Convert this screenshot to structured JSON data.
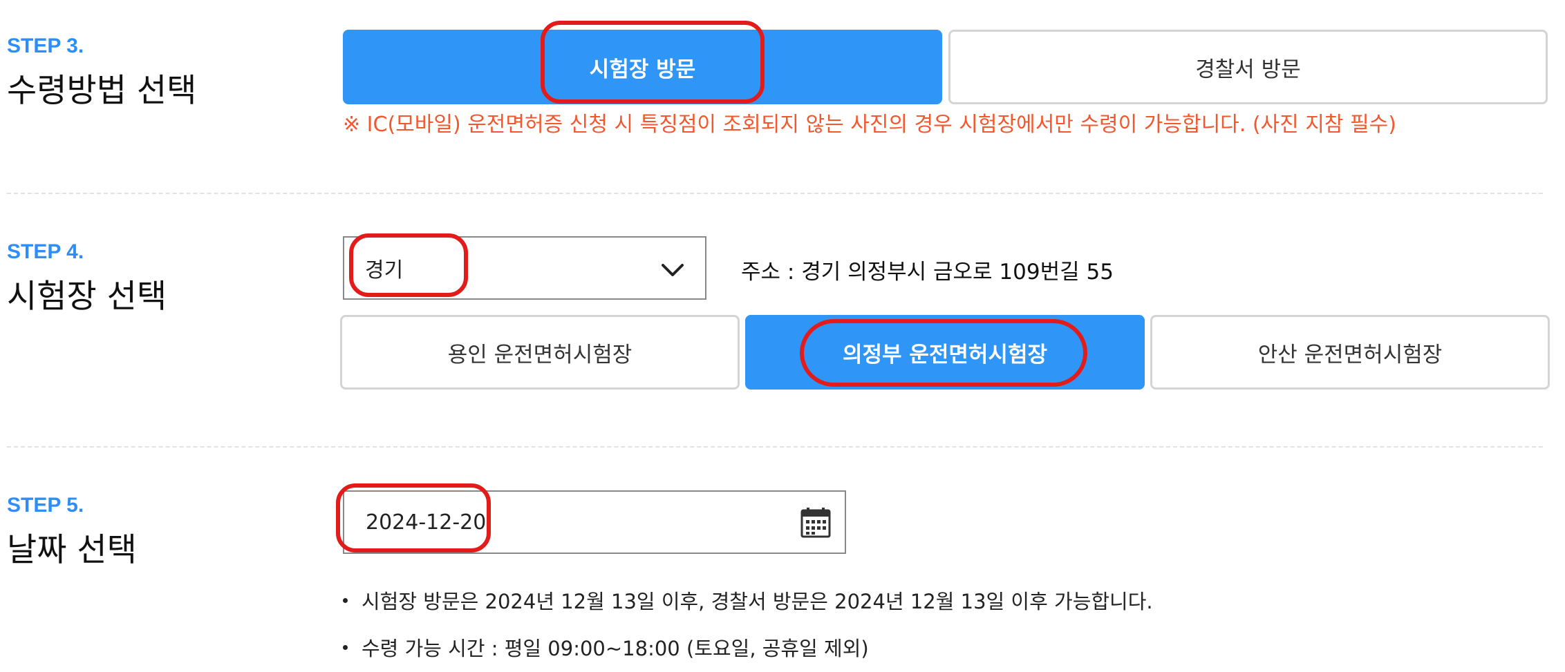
{
  "step3": {
    "label": "STEP 3.",
    "title": "수령방법 선택",
    "options": [
      "시험장 방문",
      "경찰서 방문"
    ],
    "selected": "시험장 방문",
    "notice": "※ IC(모바일) 운전면허증 신청 시 특징점이 조회되지 않는 사진의 경우 시험장에서만 수령이 가능합니다. (사진 지참 필수)"
  },
  "step4": {
    "label": "STEP 4.",
    "title": "시험장 선택",
    "region_value": "경기",
    "address": "주소 : 경기 의정부시 금오로 109번길 55",
    "centers": [
      "용인 운전면허시험장",
      "의정부 운전면허시험장",
      "안산 운전면허시험장"
    ],
    "selected": "의정부 운전면허시험장"
  },
  "step5": {
    "label": "STEP 5.",
    "title": "날짜 선택",
    "date_value": "2024-12-20",
    "notes": [
      "시험장 방문은 2024년 12월 13일 이후, 경찰서 방문은 2024년 12월 13일 이후 가능합니다.",
      "수령 가능 시간 : 평일 09:00~18:00 (토요일, 공휴일 제외)"
    ]
  },
  "colors": {
    "accent": "#2f96f8",
    "step_label": "#2f8ef5",
    "notice": "#f2572e",
    "highlight": "#e21b1b"
  },
  "icons": {
    "dropdown": "chevron-down-icon",
    "date_picker": "calendar-icon"
  }
}
